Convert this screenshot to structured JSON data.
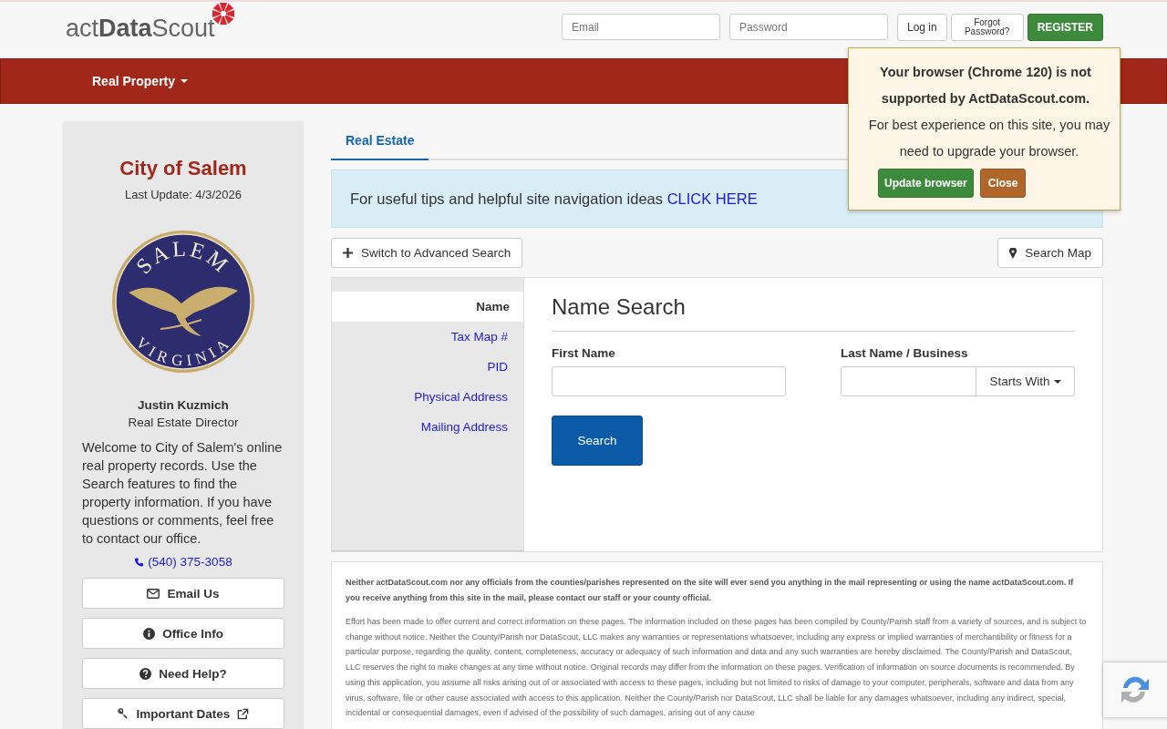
{
  "header": {
    "logo": {
      "light": "act",
      "bold": "Data",
      "tail": "Scout"
    },
    "email_placeholder": "Email",
    "password_placeholder": "Password",
    "login": "Log in",
    "forgot": "Forgot Password?",
    "register": "REGISTER"
  },
  "nav": {
    "menu": "Real Property"
  },
  "browser_notice": {
    "title": "Your browser (Chrome 120) is not supported by ActDataScout.com.",
    "body": "For best experience on this site, you may need to upgrade your browser.",
    "update": "Update browser",
    "close": "Close"
  },
  "sidebar": {
    "city": "City of Salem",
    "last_update": "Last Update: 4/3/2026",
    "seal": {
      "top": "SALEM",
      "bottom": "VIRGINIA"
    },
    "person": "Justin Kuzmich",
    "role": "Real Estate Director",
    "welcome": "Welcome to City of Salem's online real property records. Use the Search features to find the property information. If you have questions or comments, feel free to contact our office.",
    "phone": "(540) 375-3058",
    "buttons": [
      {
        "kind": "email",
        "label": "Email Us"
      },
      {
        "kind": "info",
        "label": "Office Info"
      },
      {
        "kind": "help",
        "label": "Need Help?"
      },
      {
        "kind": "dates",
        "label": "Important Dates"
      }
    ]
  },
  "tabs": [
    {
      "label": "Real Estate",
      "selected": true
    }
  ],
  "tip": {
    "text": "For useful tips and helpful site navigation ideas",
    "link": "CLICK HERE"
  },
  "advanced_button": "Switch to Advanced Search",
  "map_button": "Search Map",
  "search_types": [
    {
      "label": "Name",
      "selected": true
    },
    {
      "label": "Tax Map #",
      "selected": false
    },
    {
      "label": "PID",
      "selected": false
    },
    {
      "label": "Physical Address",
      "selected": false
    },
    {
      "label": "Mailing Address",
      "selected": false
    }
  ],
  "name_search": {
    "title": "Name Search",
    "first_label": "First Name",
    "last_label": "Last Name / Business",
    "match": "Starts With",
    "search": "Search"
  },
  "disclaimer": {
    "notice": "Neither actDataScout.com nor any officials from the counties/parishes represented on the site will ever send you anything in the mail representing or using the name actDataScout.com. If you receive anything from this site in the mail, please contact our staff or your county official.",
    "body": "Effort has been made to offer current and correct information on these pages. The information included on these pages has been compiled by County/Parish staff from a variety of sources, and is subject to change without notice. Neither the County/Parish nor DataScout, LLC makes any warranties or representations whatsoever, including any express or implied warranties of merchantibility or fitness for a particular purpose, regarding the quality, content, completeness, accuracy or adequacy of such information and data and any such warranties are hereby disclaimed. The County/Parish and DataScout, LLC reserves the right to make changes at any time without notice. Original records may differ from the information on these pages. Verification of information on source documents is recommended. By using this application, you assume all risks arising out of or associated with access to these pages, including but not limited to risks of damage to your computer, peripherals, software and data from any virus, software, file or other cause associated with access to this application. Neither the County/Parish nor DataScout, LLC shall be liable for any damages whatsoever, including any indirect, special, incidental or consequential damages, even if advised of the possibility of such damages, arising out of any cause"
  }
}
